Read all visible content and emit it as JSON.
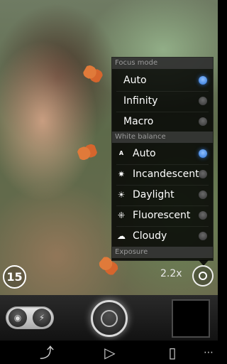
{
  "popup": {
    "focus_mode_header": "Focus mode",
    "focus_options": [
      {
        "label": "Auto",
        "selected": true
      },
      {
        "label": "Infinity",
        "selected": false
      },
      {
        "label": "Macro",
        "selected": false
      }
    ],
    "white_balance_header": "White balance",
    "white_balance_options": [
      {
        "label": "Auto",
        "icon": "auto-wb-icon",
        "selected": true
      },
      {
        "label": "Incandescent",
        "icon": "incandescent-icon",
        "selected": false
      },
      {
        "label": "Daylight",
        "icon": "sun-icon",
        "selected": false
      },
      {
        "label": "Fluorescent",
        "icon": "fluorescent-icon",
        "selected": false
      },
      {
        "label": "Cloudy",
        "icon": "cloud-icon",
        "selected": false
      }
    ],
    "exposure_header": "Exposure"
  },
  "overlay": {
    "timer": "15",
    "zoom": "2.2x"
  },
  "colors": {
    "accent_blue": "#2c73d6",
    "popup_bg": "#000000"
  }
}
